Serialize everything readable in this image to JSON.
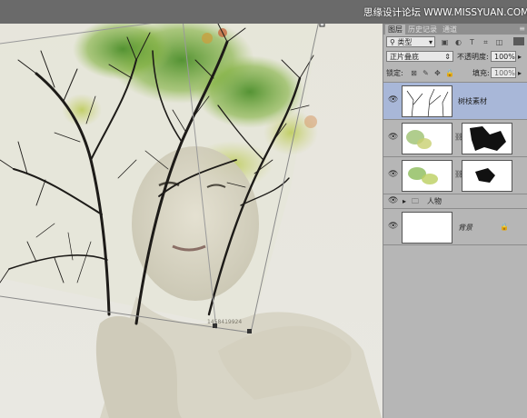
{
  "watermark": "思缘设计论坛 WWW.MISSYUAN.COM",
  "canvas": {
    "photo_credit": "1458419924"
  },
  "panel": {
    "tabs": [
      "图层",
      "历史记录",
      "通道"
    ],
    "active_tab": "图层",
    "filter": {
      "label": "类型"
    },
    "blend_mode": "正片叠底",
    "opacity_label": "不透明度:",
    "opacity_value": "100%",
    "lock_label": "锁定:",
    "fill_label": "填充:",
    "fill_value": "100%",
    "layers": [
      {
        "name": "树枝素材",
        "selected": true,
        "visible": true,
        "kind": "image"
      },
      {
        "name": "",
        "selected": false,
        "visible": true,
        "kind": "masked"
      },
      {
        "name": "",
        "selected": false,
        "visible": true,
        "kind": "masked"
      },
      {
        "name": "人物",
        "selected": false,
        "visible": true,
        "kind": "group"
      },
      {
        "name": "背景",
        "selected": false,
        "visible": true,
        "kind": "background",
        "locked": true
      }
    ]
  },
  "colors": {
    "selected_layer": "#a8b7d8",
    "panel_bg": "#b6b6b6",
    "canvas_bg": "#ececE6",
    "topbar": "#6a6a6a"
  }
}
